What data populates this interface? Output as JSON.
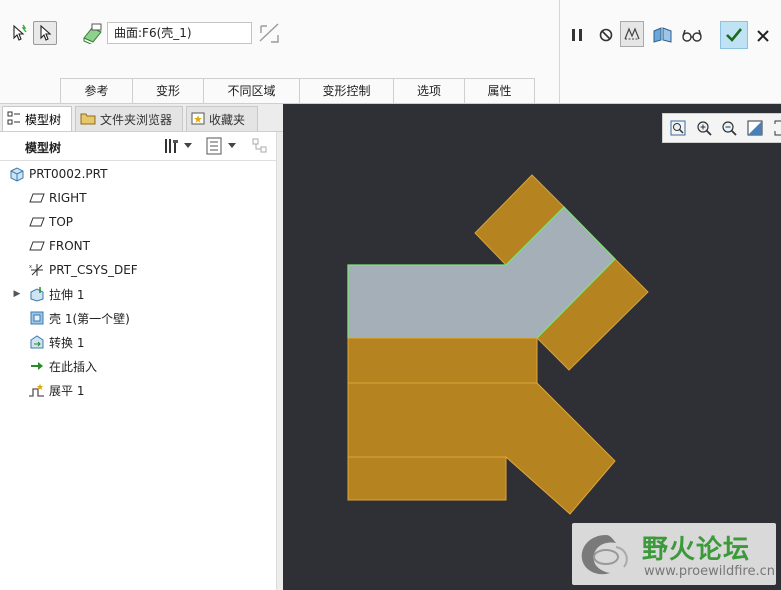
{
  "dashboard": {
    "selection_field_value": "曲面:F6(壳_1)",
    "tabs": [
      "参考",
      "变形",
      "不同区域",
      "变形控制",
      "选项",
      "属性"
    ]
  },
  "left_panel": {
    "tabs": [
      "模型树",
      "文件夹浏览器",
      "收藏夹"
    ],
    "tree_title": "模型树",
    "tree_items": [
      {
        "label": "PRT0002.PRT",
        "icon": "part-icon"
      },
      {
        "label": "RIGHT",
        "icon": "datum-plane-icon"
      },
      {
        "label": "TOP",
        "icon": "datum-plane-icon"
      },
      {
        "label": "FRONT",
        "icon": "datum-plane-icon"
      },
      {
        "label": "PRT_CSYS_DEF",
        "icon": "csys-icon"
      },
      {
        "label": "拉伸 1",
        "icon": "extrude-icon"
      },
      {
        "label": "壳 1(第一个壁)",
        "icon": "shell-icon"
      },
      {
        "label": "转换 1",
        "icon": "conversion-icon"
      },
      {
        "label": "在此插入",
        "icon": "insert-here-arrow-icon"
      },
      {
        "label": "展平 1",
        "icon": "flatten-icon"
      }
    ]
  },
  "viewport": {
    "background_color": "#2f3035",
    "sheet_color": "#b5831f",
    "selected_surface_color": "#a4afb8",
    "edge_highlight_color": "#7fe07a",
    "watermark": {
      "title": "野火论坛",
      "url": "www.proewildfire.cn"
    }
  }
}
